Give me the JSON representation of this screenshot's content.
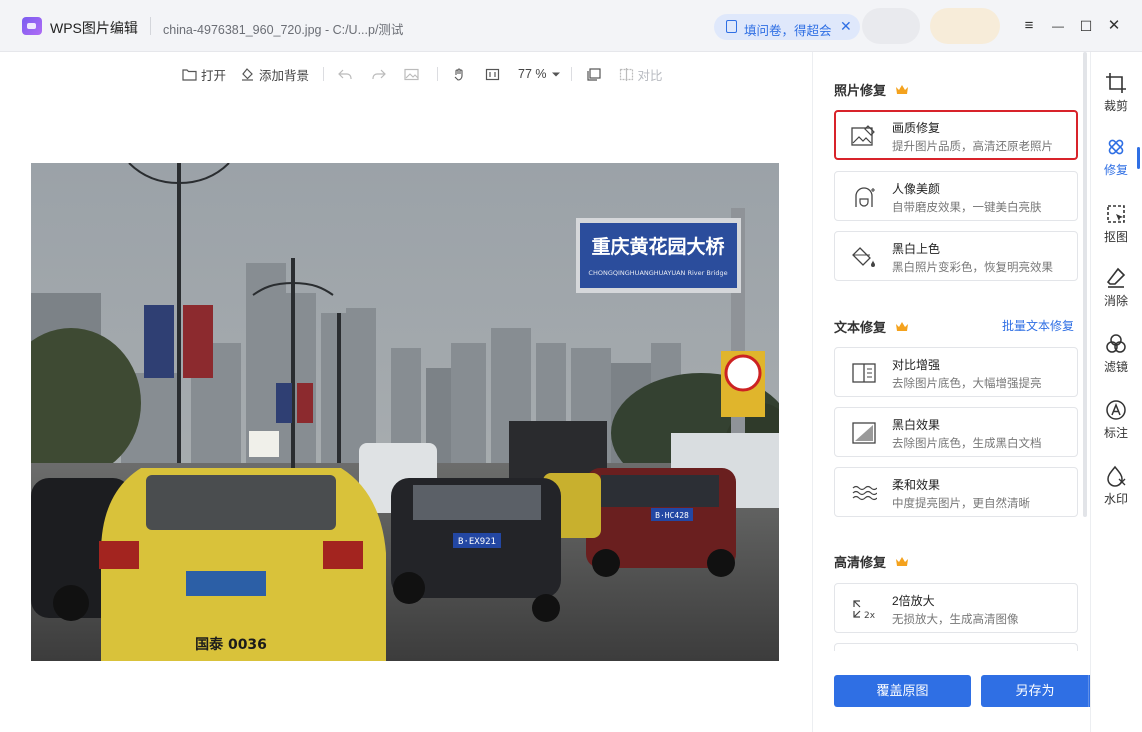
{
  "titlebar": {
    "app_title": "WPS图片编辑",
    "file_path": "china-4976381_960_720.jpg - C:/U...p/测试",
    "survey_label": "填问卷，得超会",
    "survey_close": "✕",
    "menu_icon": "≡",
    "minimize_icon": "—",
    "maximize_icon": "☐",
    "close_icon": "✕"
  },
  "toolbar": {
    "open_label": "打开",
    "add_bg_label": "添加背景",
    "zoom_value": "77 %",
    "compare_label": "对比"
  },
  "panel": {
    "photo_repair": {
      "title": "照片修复",
      "cards": [
        {
          "title": "画质修复",
          "desc": "提升图片品质，高清还原老照片",
          "icon": "image-enhance-icon"
        },
        {
          "title": "人像美颜",
          "desc": "自带磨皮效果，一键美白亮肤",
          "icon": "portrait-beauty-icon"
        },
        {
          "title": "黑白上色",
          "desc": "黑白照片变彩色，恢复明亮效果",
          "icon": "colorize-icon"
        }
      ]
    },
    "text_repair": {
      "title": "文本修复",
      "batch_link": "批量文本修复",
      "cards": [
        {
          "title": "对比增强",
          "desc": "去除图片底色，大幅增强提亮",
          "icon": "contrast-enhance-icon"
        },
        {
          "title": "黑白效果",
          "desc": "去除图片底色，生成黑白文档",
          "icon": "bw-effect-icon"
        },
        {
          "title": "柔和效果",
          "desc": "中度提亮图片，更自然清晰",
          "icon": "soft-effect-icon"
        }
      ]
    },
    "hd_repair": {
      "title": "高清修复",
      "cards": [
        {
          "title": "2倍放大",
          "desc": "无损放大，生成高清图像",
          "icon": "upscale-2x-icon",
          "icon_text": "2x"
        }
      ]
    },
    "overwrite_button": "覆盖原图",
    "save_as_button": "另存为",
    "save_as_more": "▲"
  },
  "rail": {
    "items": [
      {
        "label": "裁剪",
        "icon": "crop-icon"
      },
      {
        "label": "修复",
        "icon": "repair-icon"
      },
      {
        "label": "抠图",
        "icon": "cutout-icon"
      },
      {
        "label": "消除",
        "icon": "eraser-icon"
      },
      {
        "label": "滤镜",
        "icon": "filter-icon"
      },
      {
        "label": "标注",
        "icon": "annotate-icon"
      },
      {
        "label": "水印",
        "icon": "watermark-icon"
      }
    ]
  },
  "photo": {
    "sign_cn": "重庆黄花园大桥",
    "sign_en": "CHONGQINGHUANGHUAYUAN River Bridge",
    "plate_center": "B·EX921",
    "plate_right": "B·HC428",
    "plate_front": "国泰 0036"
  },
  "colors": {
    "accent": "#2f6fe4",
    "highlight_border": "#d8232a",
    "taxi_yellow": "#d9c23a"
  }
}
